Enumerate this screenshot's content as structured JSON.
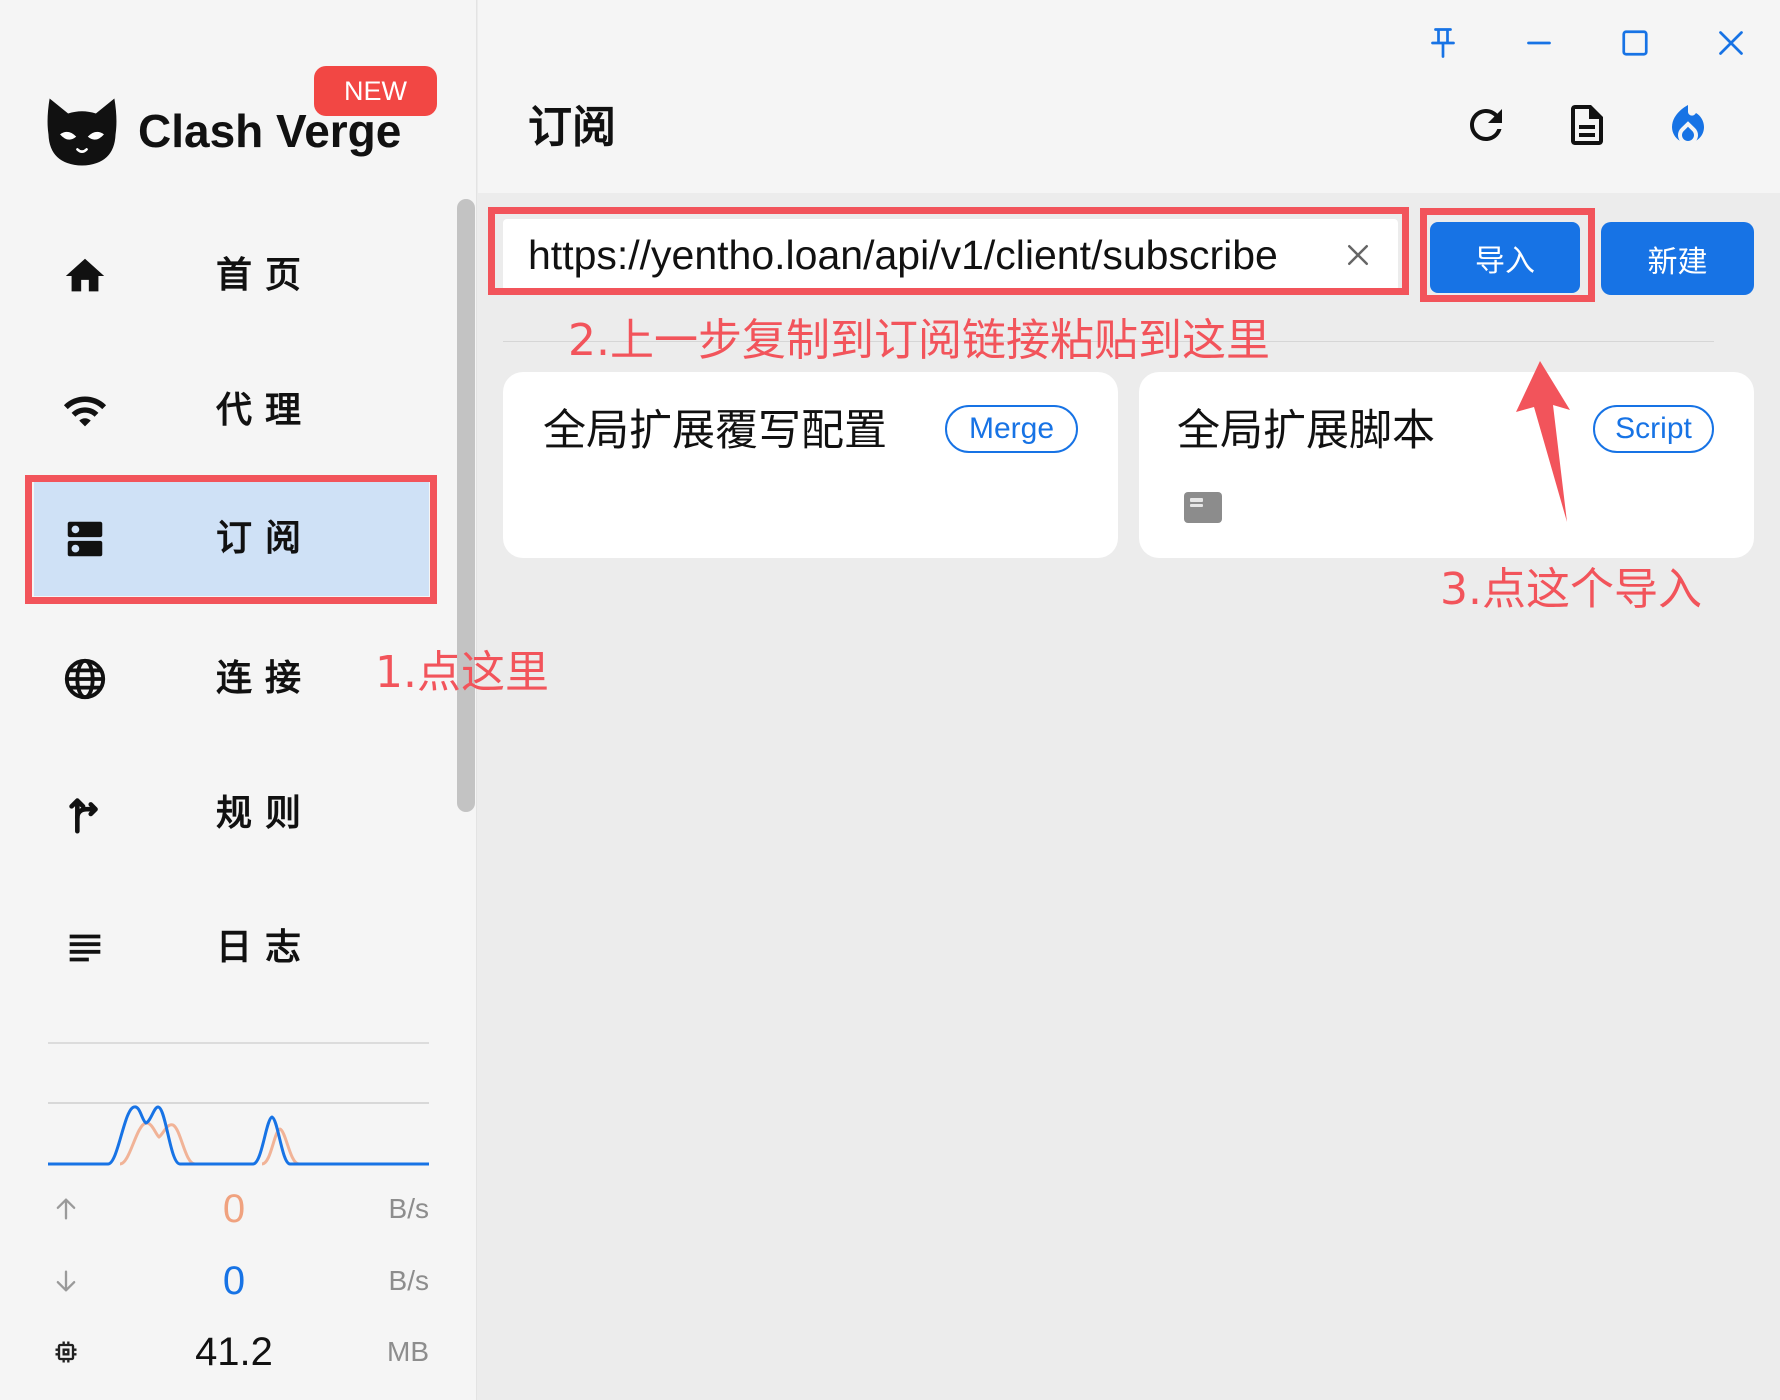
{
  "colors": {
    "accent": "#1773e5",
    "annotation": "#f2545b",
    "upload": "#f0a27f",
    "active_nav_bg": "#cfe1f6"
  },
  "window_controls": [
    "pin-icon",
    "minimize-icon",
    "maximize-icon",
    "close-icon"
  ],
  "sidebar": {
    "logo": {
      "text": "Clash Verge",
      "badge": "NEW",
      "icon": "cat-logo-icon"
    },
    "nav": [
      {
        "label": "首页",
        "icon": "home-icon"
      },
      {
        "label": "代理",
        "icon": "wifi-icon"
      },
      {
        "label": "订阅",
        "icon": "dns-icon",
        "active": true
      },
      {
        "label": "连接",
        "icon": "globe-icon"
      },
      {
        "label": "规则",
        "icon": "route-icon"
      },
      {
        "label": "日志",
        "icon": "log-lines-icon"
      }
    ],
    "traffic": {
      "upload": {
        "value": "0",
        "unit": "B/s",
        "icon": "arrow-up-icon"
      },
      "download": {
        "value": "0",
        "unit": "B/s",
        "icon": "arrow-down-icon"
      },
      "memory": {
        "value": "41.2",
        "unit": "MB",
        "icon": "memory-chip-icon"
      }
    }
  },
  "header": {
    "title": "订阅",
    "actions": [
      "refresh-icon",
      "document-icon",
      "fire-icon"
    ]
  },
  "import_bar": {
    "url_value": "https://yentho.loan/api/v1/client/subscribe",
    "import_label": "导入",
    "new_label": "新建"
  },
  "cards": [
    {
      "title": "全局扩展覆写配置",
      "badge": "Merge"
    },
    {
      "title": "全局扩展脚本",
      "badge": "Script",
      "icon": "file-icon"
    }
  ],
  "annotations": {
    "step1": "1.点这里",
    "step2": "2.上一步复制到订阅链接粘贴到这里",
    "step3": "3.点这个导入"
  }
}
